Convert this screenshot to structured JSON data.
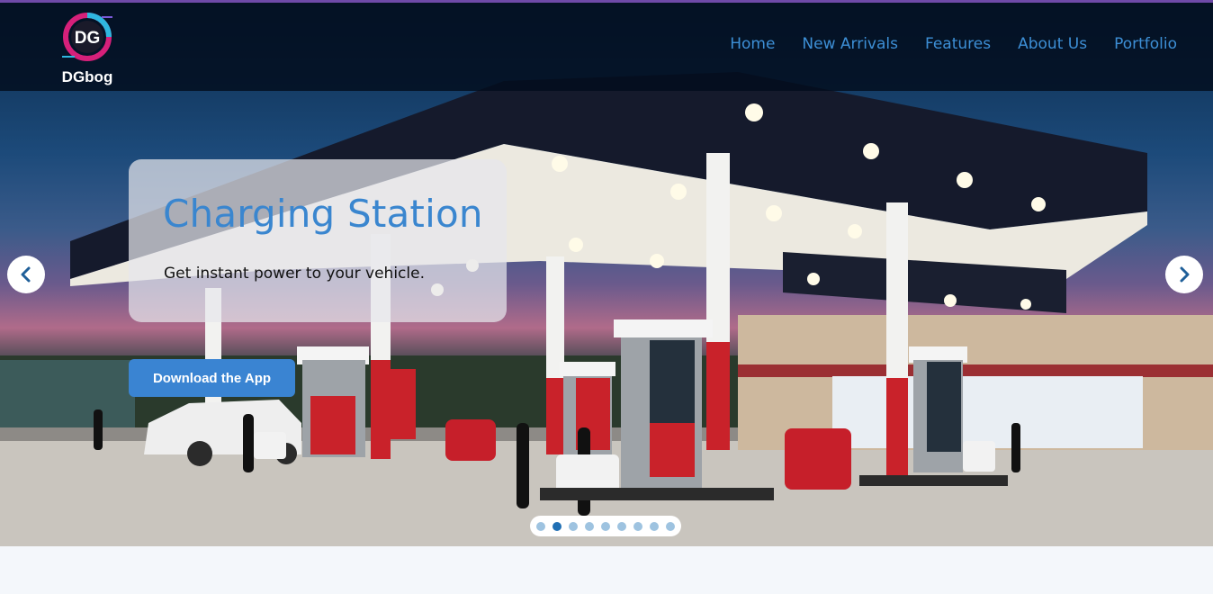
{
  "brand": {
    "name": "DGbog",
    "logo_letters": "DG"
  },
  "nav": {
    "items": [
      {
        "label": "Home"
      },
      {
        "label": "New Arrivals"
      },
      {
        "label": "Features"
      },
      {
        "label": "About Us"
      },
      {
        "label": "Portfolio"
      }
    ]
  },
  "slide": {
    "title": "Charging Station",
    "subtitle": "Get instant power to your vehicle.",
    "cta_label": "Download the App"
  },
  "carousel": {
    "slide_count": 9,
    "active_index": 1,
    "prev_icon": "chevron-left-icon",
    "next_icon": "chevron-right-icon"
  },
  "colors": {
    "accent": "#3a84d2",
    "nav_link": "#3d8fd6",
    "navbar_bg": "#020c1c",
    "title": "#3a86cf"
  }
}
